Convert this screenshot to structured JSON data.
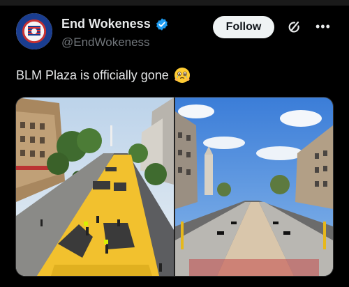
{
  "author": {
    "display_name": "End Wokeness",
    "handle": "@EndWokeness",
    "verified": true,
    "avatar_icon": "end-wokeness-avatar"
  },
  "actions": {
    "follow_label": "Follow",
    "grok_icon": "grok-icon",
    "more_icon": "more-icon",
    "more_glyph": "•••"
  },
  "tweet": {
    "text": "BLM Plaza is officially gone",
    "emoji": "face-holding-back-tears"
  },
  "media": {
    "left_image": "street-with-yellow-blm-mural",
    "right_image": "street-with-mural-removed"
  },
  "colors": {
    "background": "#000000",
    "text": "#e7e9ea",
    "secondary": "#71767b",
    "verified": "#1d9bf0",
    "mural_yellow": "#f2c12e"
  }
}
